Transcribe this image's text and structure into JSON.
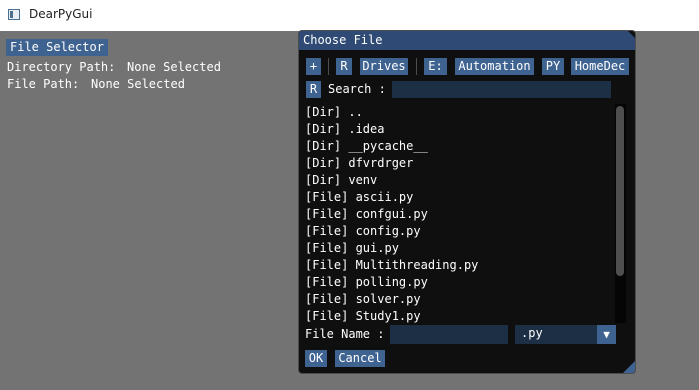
{
  "window": {
    "title": "DearPyGui"
  },
  "main": {
    "file_selector_button": "File Selector",
    "directory_label": "Directory Path:",
    "directory_value": "None Selected",
    "file_label": "File Path:",
    "file_value": "None Selected"
  },
  "dialog": {
    "title": "Choose File",
    "toolbar": {
      "add": "+",
      "refresh": "R",
      "drives": "Drives",
      "drive_e": "E:",
      "automation": "Automation",
      "py": "PY",
      "homedec": "HomeDec"
    },
    "search": {
      "refresh": "R",
      "label": "Search :",
      "value": ""
    },
    "items": [
      "[Dir] ..",
      "[Dir] .idea",
      "[Dir] __pycache__",
      "[Dir] dfvrdrger",
      "[Dir] venv",
      "[File] ascii.py",
      "[File] confgui.py",
      "[File] config.py",
      "[File] gui.py",
      "[File] Multithreading.py",
      "[File] polling.py",
      "[File] solver.py",
      "[File] Study1.py"
    ],
    "file_name_label": "File Name :",
    "file_name_value": "",
    "filter_value": ".py",
    "ok": "OK",
    "cancel": "Cancel"
  },
  "colors": {
    "accent": "#3f6391",
    "title_bar": "#2f4b75",
    "background": "#737373",
    "dialog_bg": "#0f0f0f"
  }
}
